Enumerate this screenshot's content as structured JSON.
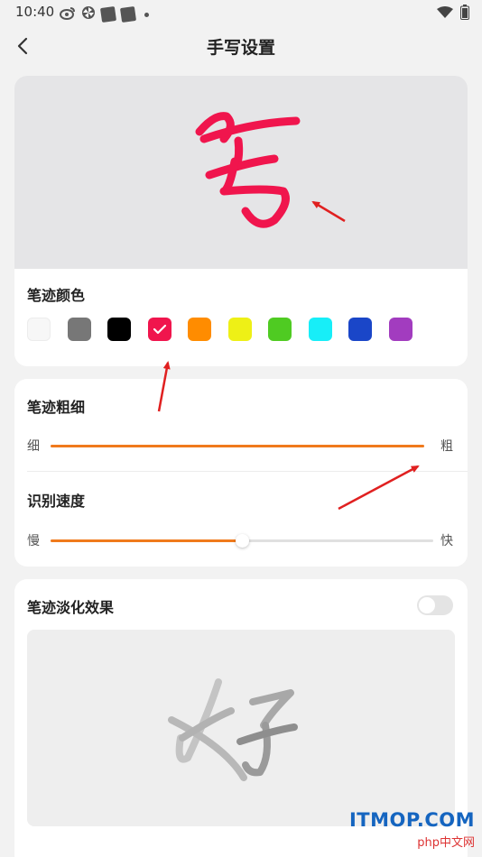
{
  "status_bar": {
    "time": "10:40",
    "icons_left": [
      "weibo-icon",
      "pinwheel-icon",
      "app-icon",
      "app-icon",
      "dot-icon"
    ],
    "icons_right": [
      "wifi-icon",
      "battery-icon"
    ]
  },
  "header": {
    "title": "手写设置",
    "back_icon": "chevron-left-icon"
  },
  "preview": {
    "sample_char": "写",
    "ink_color": "#f0154d"
  },
  "stroke_color": {
    "label": "笔迹颜色",
    "swatches": [
      "#f7f7f7",
      "#777777",
      "#000000",
      "#f0154d",
      "#ff8c00",
      "#eef016",
      "#4fcb22",
      "#17eef8",
      "#1a46c8",
      "#a23cbf"
    ],
    "selected_index": 3
  },
  "stroke_width": {
    "label": "笔迹粗细",
    "min_label": "细",
    "max_label": "粗",
    "value_fraction": 1.0
  },
  "recognition_speed": {
    "label": "识别速度",
    "min_label": "慢",
    "max_label": "快",
    "value_fraction": 0.5
  },
  "stroke_fade": {
    "label": "笔迹淡化效果",
    "toggle_on": false,
    "sample_char": "好"
  },
  "watermark": {
    "main": "ITMOP.COM",
    "sub": "php中文网"
  },
  "colors": {
    "accent": "#f07a1c",
    "annotation_arrow": "#e02020"
  }
}
